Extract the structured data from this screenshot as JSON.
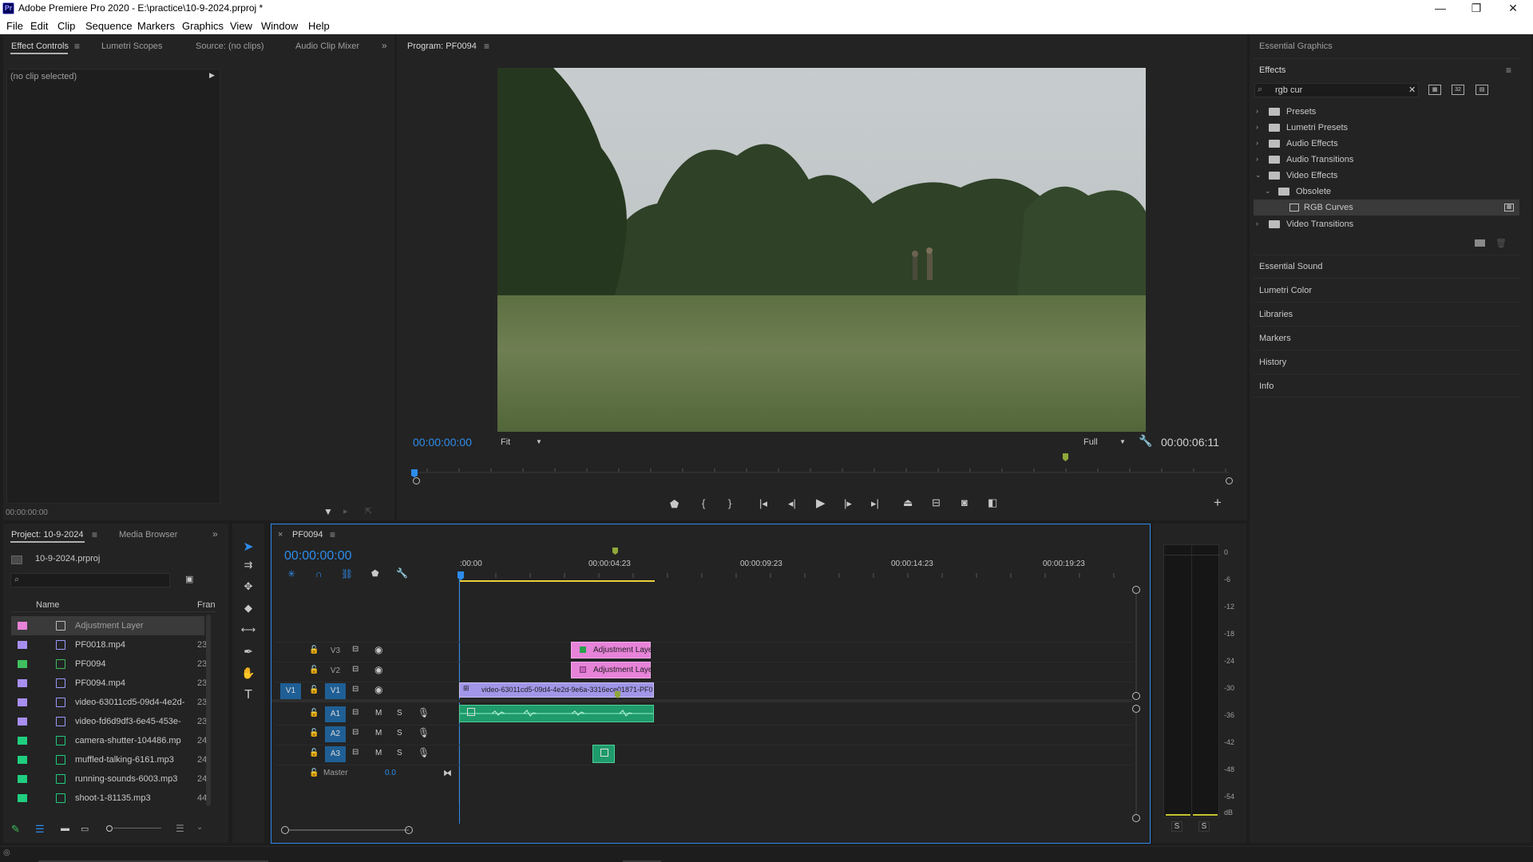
{
  "window": {
    "title": "Adobe Premiere Pro 2020 - E:\\practice\\10-9-2024.prproj *",
    "logo": "Pr",
    "minimize_glyph": "—",
    "restore_glyph": "❐",
    "close_glyph": "✕"
  },
  "menu": [
    "File",
    "Edit",
    "Clip",
    "Sequence",
    "Markers",
    "Graphics",
    "View",
    "Window",
    "Help"
  ],
  "source_panel": {
    "tabs": [
      "Effect Controls",
      "Lumetri Scopes",
      "Source: (no clips)",
      "Audio Clip Mixer"
    ],
    "no_clip": "(no clip selected)",
    "timecode": "00:00:00:00"
  },
  "program": {
    "title": "Program: PF0094",
    "timecode": "00:00:00:00",
    "zoom": "Fit",
    "resolution": "Full",
    "duration": "00:00:06:11"
  },
  "right_panel": {
    "essential_graphics": "Essential Graphics",
    "effects_title": "Effects",
    "search_value": "rgb cur",
    "tree": [
      {
        "label": "Presets",
        "expanded": false,
        "level": 0
      },
      {
        "label": "Lumetri Presets",
        "expanded": false,
        "level": 0
      },
      {
        "label": "Audio Effects",
        "expanded": false,
        "level": 0
      },
      {
        "label": "Audio Transitions",
        "expanded": false,
        "level": 0
      },
      {
        "label": "Video Effects",
        "expanded": true,
        "level": 0
      },
      {
        "label": "Obsolete",
        "expanded": true,
        "level": 1
      },
      {
        "label": "RGB Curves",
        "expanded": false,
        "level": 2
      },
      {
        "label": "Video Transitions",
        "expanded": false,
        "level": 0
      }
    ],
    "sections": [
      "Essential Sound",
      "Lumetri Color",
      "Libraries",
      "Markers",
      "History",
      "Info"
    ]
  },
  "project": {
    "tabs": [
      "Project: 10-9-2024",
      "Media Browser"
    ],
    "file": "10-9-2024.prproj",
    "columns": {
      "name": "Name",
      "rate": "Fran"
    },
    "items": [
      {
        "name": "Adjustment Layer",
        "rate": "",
        "color": "#e783d9",
        "icon": "adjustment-layer-icon"
      },
      {
        "name": "PF0018.mp4",
        "rate": "23",
        "color": "#a78ef0",
        "icon": "video-file-icon"
      },
      {
        "name": "PF0094",
        "rate": "23",
        "color": "#3fbf5f",
        "icon": "sequence-icon"
      },
      {
        "name": "PF0094.mp4",
        "rate": "23",
        "color": "#a78ef0",
        "icon": "video-file-icon"
      },
      {
        "name": "video-63011cd5-09d4-4e2d-",
        "rate": "23",
        "color": "#a78ef0",
        "icon": "video-file-icon"
      },
      {
        "name": "video-fd6d9df3-6e45-453e-",
        "rate": "23",
        "color": "#a78ef0",
        "icon": "video-file-icon"
      },
      {
        "name": "camera-shutter-104486.mp",
        "rate": "24",
        "color": "#1fcf7f",
        "icon": "audio-file-icon"
      },
      {
        "name": "muffled-talking-6161.mp3",
        "rate": "24",
        "color": "#1fcf7f",
        "icon": "audio-file-icon"
      },
      {
        "name": "running-sounds-6003.mp3",
        "rate": "24",
        "color": "#1fcf7f",
        "icon": "audio-file-icon"
      },
      {
        "name": "shoot-1-81135.mp3",
        "rate": "44",
        "color": "#1fcf7f",
        "icon": "audio-file-icon"
      }
    ]
  },
  "timeline": {
    "sequence": "PF0094",
    "timecode": "00:00:00:00",
    "ruler": [
      ":00:00",
      "00:00:04:23",
      "00:00:09:23",
      "00:00:14:23",
      "00:00:19:23"
    ],
    "tracks": {
      "v3": "V3",
      "v2": "V2",
      "v1": "V1",
      "v1_src": "V1",
      "a1": "A1",
      "a2": "A2",
      "a3": "A3",
      "mute": "M",
      "solo": "S",
      "master": "Master",
      "master_value": "0.0"
    },
    "clips": {
      "adj1": "Adjustment Laye",
      "adj2": "Adjustment Laye",
      "video": "video-63011cd5-09d4-4e2d-9e6a-3316ece01871-PF0"
    }
  },
  "meter": {
    "ticks": [
      "0",
      "-6",
      "-12",
      "-18",
      "-24",
      "-30",
      "-36",
      "-42",
      "-48",
      "-54",
      "dB"
    ],
    "solo_left": "S",
    "solo_right": "S"
  }
}
